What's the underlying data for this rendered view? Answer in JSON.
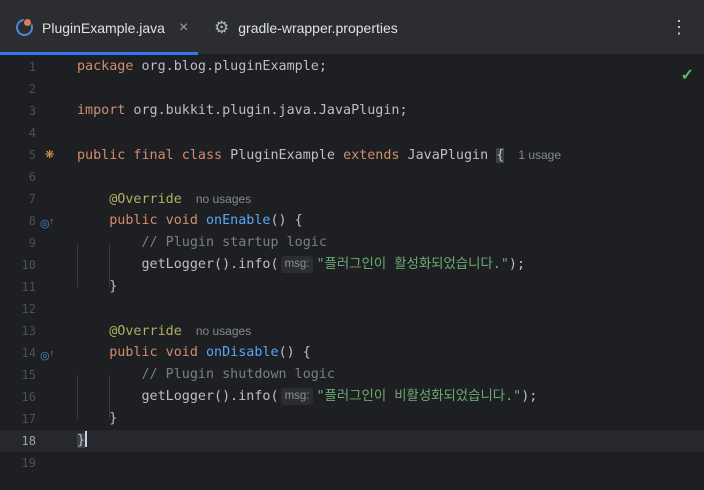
{
  "tabs": [
    {
      "label": "PluginExample.java",
      "close": "×",
      "active": true,
      "icon": "java-class-icon"
    },
    {
      "label": "gradle-wrapper.properties",
      "active": false,
      "icon": "gear-icon"
    }
  ],
  "menu_icon": "⋮",
  "status_icon": "✓",
  "editor": {
    "line_numbers": [
      "1",
      "2",
      "3",
      "4",
      "5",
      "6",
      "7",
      "8",
      "9",
      "10",
      "11",
      "12",
      "13",
      "14",
      "15",
      "16",
      "17",
      "18",
      "19"
    ],
    "current_line": "18",
    "l1": {
      "kw": "package",
      "rest": " org.blog.pluginExample;"
    },
    "l3": {
      "kw": "import",
      "rest": " org.bukkit.plugin.java.JavaPlugin;"
    },
    "l5": {
      "kw1": "public final class",
      "name": " PluginExample ",
      "kw2": "extends",
      "sup": " JavaPlugin ",
      "brace": "{",
      "hint": "1 usage"
    },
    "l7": {
      "ann": "@Override",
      "hint": "no usages"
    },
    "l8": {
      "kw": "public void",
      "fn": "onEnable",
      "rest": "() {"
    },
    "l9": {
      "comment": "// Plugin startup logic"
    },
    "l10": {
      "call": "getLogger().info(",
      "param": "msg:",
      "str": "\"플러그인이 활성화되었습니다.\"",
      "end": ");"
    },
    "l11": {
      "text": "}"
    },
    "l13": {
      "ann": "@Override",
      "hint": "no usages"
    },
    "l14": {
      "kw": "public void",
      "fn": "onDisable",
      "rest": "() {"
    },
    "l15": {
      "comment": "// Plugin shutdown logic"
    },
    "l16": {
      "call": "getLogger().info(",
      "param": "msg:",
      "str": "\"플러그인이 비활성화되었습니다.\"",
      "end": ");"
    },
    "l17": {
      "text": "}"
    },
    "l18": {
      "text": "}"
    }
  }
}
